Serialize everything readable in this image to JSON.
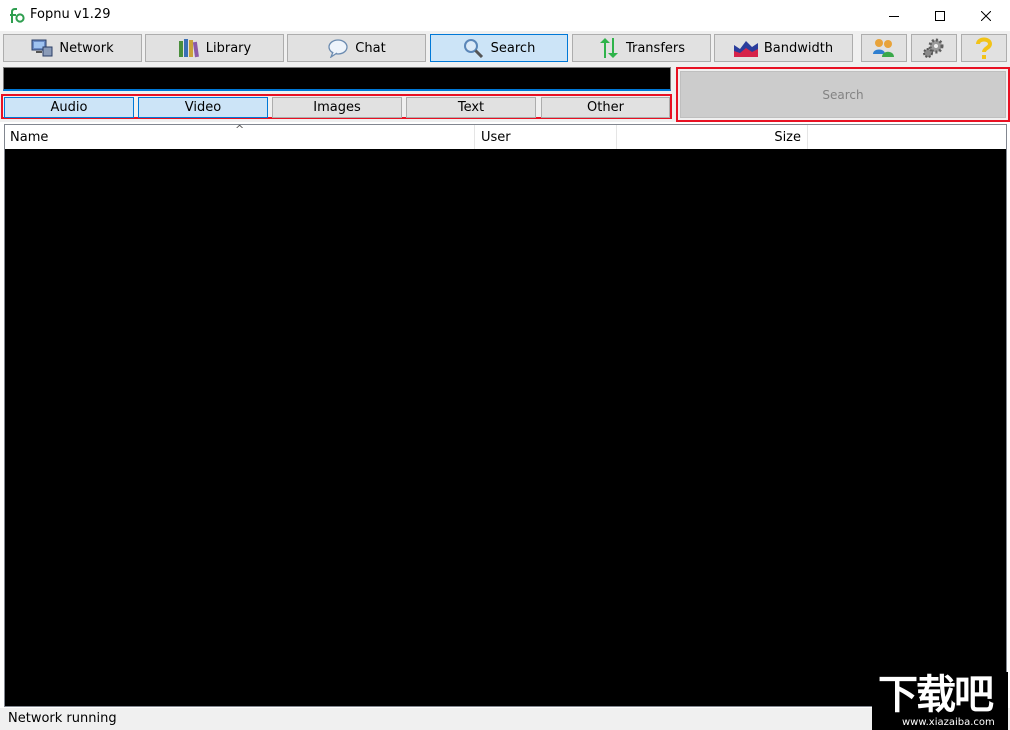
{
  "window": {
    "title": "Fopnu v1.29",
    "controls": {
      "minimize": "minimize",
      "maximize": "maximize",
      "close": "close"
    }
  },
  "toolbar": {
    "network": "Network",
    "library": "Library",
    "chat": "Chat",
    "search": "Search",
    "transfers": "Transfers",
    "bandwidth": "Bandwidth",
    "active_tab": "search"
  },
  "search": {
    "query_value": "",
    "filters": [
      "Audio",
      "Video",
      "Images",
      "Text",
      "Other"
    ],
    "active_filters": [
      "Audio",
      "Video"
    ],
    "button_label": "Search"
  },
  "results": {
    "columns": [
      "Name",
      "User",
      "Size"
    ],
    "sorted_by": "Name",
    "rows": []
  },
  "status": {
    "text": "Network running"
  },
  "watermark": {
    "big": "下载吧",
    "small": "www.xiazaiba.com"
  },
  "colors": {
    "accent_border": "#0078d7",
    "active_bg": "#cce4f7",
    "highlight_red": "#e81123",
    "results_bg": "#000000"
  }
}
